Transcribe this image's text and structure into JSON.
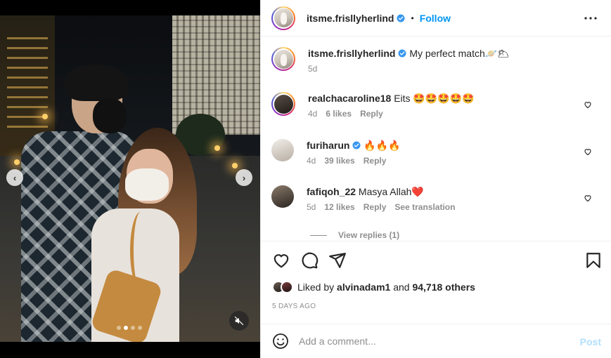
{
  "post": {
    "author": "itsme.frisllyherlind",
    "follow_label": "Follow",
    "separator": "•",
    "caption": "My perfect match🪐🌥",
    "caption_age": "5d",
    "carousel": {
      "slide_count": 4,
      "active_slide": 2
    },
    "likes_prefix": "Liked by",
    "liked_by": "alvinadam1",
    "likes_joiner": "and",
    "likes_others": "94,718 others",
    "date": "5 DAYS AGO"
  },
  "comments": [
    {
      "user": "realchacaroline18",
      "text": "Eits 🤩🤩🤩🤩🤩",
      "age": "4d",
      "likes": "6 likes",
      "reply": "Reply",
      "verified": false
    },
    {
      "user": "furiharun",
      "text": "🔥🔥🔥",
      "age": "4d",
      "likes": "39 likes",
      "reply": "Reply",
      "verified": true
    },
    {
      "user": "fafiqoh_22",
      "text": "Masya Allah❤️",
      "age": "5d",
      "likes": "12 likes",
      "reply": "Reply",
      "translate": "See translation",
      "verified": false
    }
  ],
  "view_replies": "View replies (1)",
  "composer": {
    "placeholder": "Add a comment...",
    "post_label": "Post"
  },
  "colors": {
    "link": "#0095f6",
    "verified": "#3897f0",
    "post_disabled": "#b2dffc",
    "secondary_text": "#8e8e8e"
  },
  "icons": [
    "chevron-left-icon",
    "chevron-right-icon",
    "mute-icon",
    "verified-icon",
    "more-icon",
    "heart-icon",
    "comment-icon",
    "share-icon",
    "bookmark-icon",
    "emoji-icon"
  ]
}
